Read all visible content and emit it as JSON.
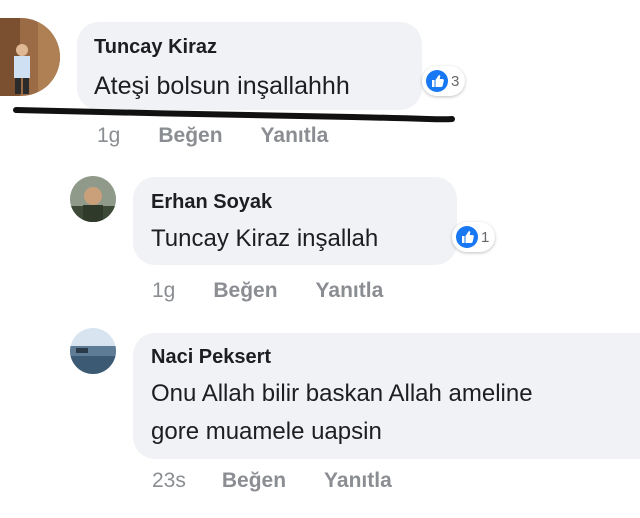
{
  "comments": [
    {
      "author": "Tuncay Kiraz",
      "text": "Ateşi bolsun inşallahhh",
      "reaction_count": "3",
      "time": "1g",
      "like_label": "Beğen",
      "reply_label": "Yanıtla"
    },
    {
      "author": "Erhan Soyak",
      "text": "Tuncay Kiraz inşallah",
      "reaction_count": "1",
      "time": "1g",
      "like_label": "Beğen",
      "reply_label": "Yanıtla"
    },
    {
      "author": "Naci Peksert",
      "text_lines": [
        "Onu Allah bilir baskan Allah ameline",
        "gore muamele uapsin"
      ],
      "time": "23s",
      "like_label": "Beğen",
      "reply_label": "Yanıtla"
    }
  ],
  "icons": {
    "reaction": "like-thumb-icon",
    "avatar": "profile-photo"
  },
  "colors": {
    "like_blue": "#1877f2",
    "bubble": "#f0f2f5",
    "meta": "#8a8d91",
    "scribble": "#111111"
  }
}
